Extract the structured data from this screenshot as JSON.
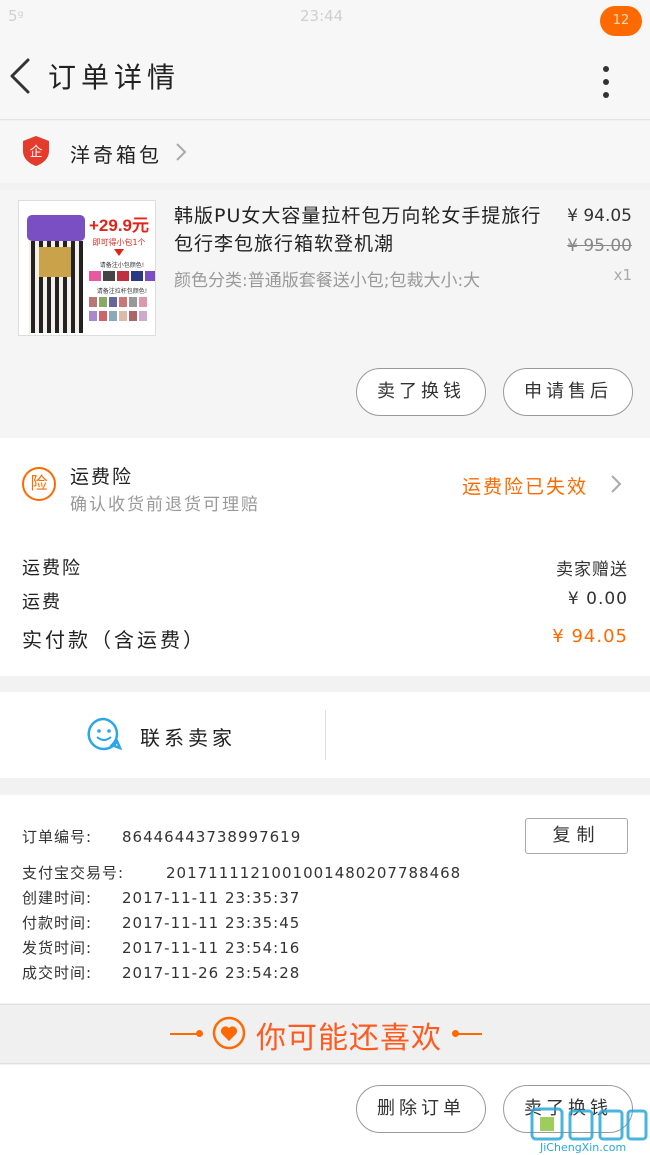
{
  "status_bar": {
    "signal": "5ᵍ",
    "time": "23:44"
  },
  "header": {
    "title": "订单详情",
    "message_count": "12"
  },
  "shop": {
    "name": "洋奇箱包"
  },
  "product": {
    "thumb_promo": "+29.9元",
    "thumb_sub": "即可得小包1个",
    "thumb_note1": "请备注小包颜色!",
    "thumb_note2": "请备注拉杆包颜色!",
    "title": "韩版PU女大容量拉杆包万向轮女手提旅行包行李包旅行箱软登机潮",
    "sku": "颜色分类:普通版套餐送小包;包裁大小:大",
    "price": "¥ 94.05",
    "original_price": "¥ 95.00",
    "quantity": "x1",
    "buttons": {
      "refund": "卖了换钱",
      "aftersale": "申请售后"
    }
  },
  "insurance": {
    "icon_text": "险",
    "title": "运费险",
    "subtitle": "确认收货前退货可理赔",
    "status": "运费险已失效"
  },
  "fees": [
    {
      "label": "运费险",
      "value": "卖家赠送"
    },
    {
      "label": "运费",
      "value": "¥ 0.00"
    },
    {
      "label": "实付款（含运费）",
      "value": "¥ 94.05"
    }
  ],
  "contact": {
    "label": "联系卖家"
  },
  "order_info": {
    "order_no_label": "订单编号:",
    "order_no": "86446443738997619",
    "copy_label": "复制",
    "alipay_label": "支付宝交易号:",
    "alipay_no": "2017111121001001480207788468",
    "times": [
      {
        "label": "创建时间:",
        "value": "2017-11-11  23:35:37"
      },
      {
        "label": "付款时间:",
        "value": "2017-11-11  23:35:45"
      },
      {
        "label": "发货时间:",
        "value": "2017-11-11  23:54:16"
      },
      {
        "label": "成交时间:",
        "value": "2017-11-26  23:54:28"
      }
    ]
  },
  "recommend": {
    "title": "你可能还喜欢"
  },
  "bottom": {
    "delete_label": "删除订单",
    "refund_label": "卖了换钱"
  },
  "watermark": {
    "text": "JiChengXin.com"
  },
  "colors": {
    "accent": "#ff6a00",
    "contact_blue": "#2aa7e8",
    "shop_red": "#e53b2c"
  }
}
